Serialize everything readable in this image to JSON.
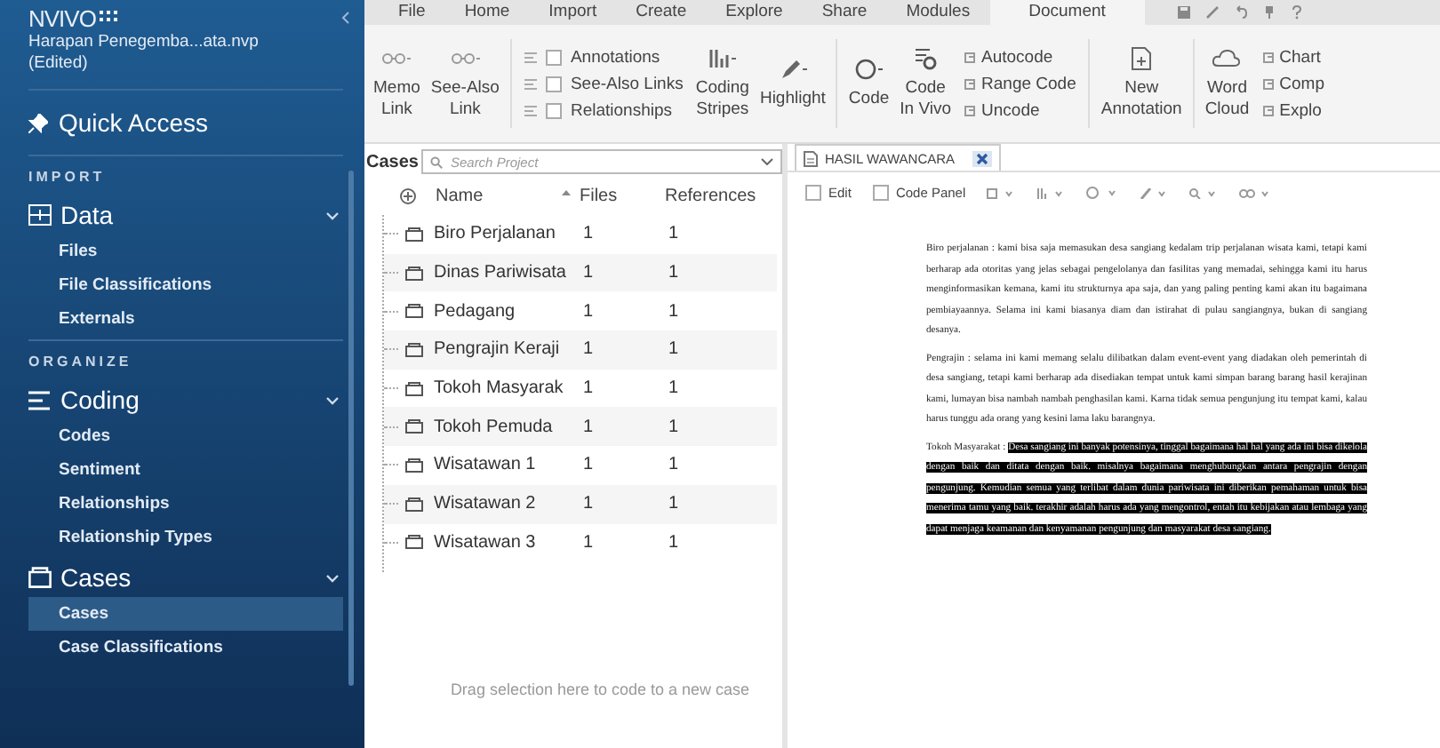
{
  "sidebar": {
    "app_name": "NVIVO",
    "project_name": "Harapan Penegemba...ata.nvp",
    "project_status": "(Edited)",
    "quick_access": "Quick Access",
    "sections": [
      {
        "heading": "IMPORT",
        "groups": [
          {
            "kind": "data",
            "label": "Data",
            "expanded": true,
            "items": [
              {
                "label": "Files",
                "selected": false
              },
              {
                "label": "File Classifications",
                "selected": false
              },
              {
                "label": "Externals",
                "selected": false
              }
            ]
          }
        ]
      },
      {
        "heading": "ORGANIZE",
        "groups": [
          {
            "kind": "coding",
            "label": "Coding",
            "expanded": true,
            "items": [
              {
                "label": "Codes",
                "selected": false
              },
              {
                "label": "Sentiment",
                "selected": false
              },
              {
                "label": "Relationships",
                "selected": false
              },
              {
                "label": "Relationship Types",
                "selected": false
              }
            ]
          },
          {
            "kind": "cases",
            "label": "Cases",
            "expanded": true,
            "items": [
              {
                "label": "Cases",
                "selected": true
              },
              {
                "label": "Case Classifications",
                "selected": false
              }
            ]
          }
        ]
      }
    ]
  },
  "ribbon": {
    "tabs": [
      {
        "label": "File",
        "selected": false
      },
      {
        "label": "Home",
        "selected": false
      },
      {
        "label": "Import",
        "selected": false
      },
      {
        "label": "Create",
        "selected": false
      },
      {
        "label": "Explore",
        "selected": false
      },
      {
        "label": "Share",
        "selected": false
      },
      {
        "label": "Modules",
        "selected": false
      },
      {
        "label": "Document",
        "selected": true
      }
    ],
    "items": [
      {
        "kind": "large",
        "lines": [
          "Memo",
          "Link"
        ]
      },
      {
        "kind": "large",
        "lines": [
          "See-Also",
          "Link"
        ]
      },
      {
        "kind": "stack",
        "rows": [
          {
            "kind": "check",
            "label": "Annotations",
            "checked": false
          },
          {
            "kind": "check",
            "label": "See-Also Links",
            "checked": false
          },
          {
            "kind": "check",
            "label": "Relationships",
            "checked": false
          }
        ]
      },
      {
        "kind": "large",
        "lines": [
          "Coding",
          "Stripes"
        ]
      },
      {
        "kind": "large",
        "lines": [
          "Highlight"
        ]
      },
      {
        "kind": "large",
        "lines": [
          "Code"
        ]
      },
      {
        "kind": "large",
        "lines": [
          "Code",
          "In Vivo"
        ]
      },
      {
        "kind": "stack",
        "rows": [
          {
            "kind": "command",
            "label": "Autocode"
          },
          {
            "kind": "command",
            "label": "Range Code"
          },
          {
            "kind": "command",
            "label": "Uncode"
          }
        ]
      },
      {
        "kind": "large",
        "lines": [
          "New",
          "Annotation"
        ]
      },
      {
        "kind": "large",
        "lines": [
          "Word",
          "Cloud"
        ]
      },
      {
        "kind": "stack",
        "rows": [
          {
            "kind": "command",
            "label": "Chart"
          },
          {
            "kind": "command",
            "label": "Comp"
          },
          {
            "kind": "command",
            "label": "Explo"
          }
        ]
      }
    ]
  },
  "cases": {
    "title": "Cases",
    "search": {
      "placeholder": "Search Project"
    },
    "columns": [
      "Name",
      "Files",
      "References"
    ],
    "rows": [
      {
        "name": "Biro Perjalanan",
        "files": "1",
        "references": "1"
      },
      {
        "name": "Dinas Pariwisata",
        "files": "1",
        "references": "1"
      },
      {
        "name": "Pedagang",
        "files": "1",
        "references": "1"
      },
      {
        "name": "Pengrajin Keraji",
        "files": "1",
        "references": "1"
      },
      {
        "name": "Tokoh Masyarak",
        "files": "1",
        "references": "1"
      },
      {
        "name": "Tokoh Pemuda",
        "files": "1",
        "references": "1"
      },
      {
        "name": "Wisatawan 1",
        "files": "1",
        "references": "1"
      },
      {
        "name": "Wisatawan 2",
        "files": "1",
        "references": "1"
      },
      {
        "name": "Wisatawan 3",
        "files": "1",
        "references": "1"
      }
    ],
    "empty_hint": "Drag selection here to code to a new case"
  },
  "document": {
    "tab_title": "HASIL WAWANCARA",
    "checks": [
      {
        "label": "Edit",
        "checked": false
      },
      {
        "label": "Code Panel",
        "checked": false
      }
    ],
    "paragraphs": [
      {
        "segments": [
          {
            "text": "Biro perjalanan : kami bisa saja memasukan desa sangiang kedalam trip perjalanan wisata kami, tetapi kami berharap ada otoritas yang jelas sebagai pengelolanya dan fasilitas yang memadai, sehingga kami itu harus menginformasikan kemana, kami itu strukturnya apa saja, dan yang paling penting kami akan itu bagaimana pembiayaannya. Selama ini kami biasanya diam dan istirahat di pulau sangiangnya, bukan di sangiang desanya.",
            "highlighted": false
          }
        ]
      },
      {
        "segments": [
          {
            "text": "Pengrajin : selama ini kami memang selalu dilibatkan dalam event-event yang diadakan oleh pemerintah di desa sangiang, tetapi kami berharap ada disediakan tempat untuk kami simpan barang barang hasil kerajinan kami, lumayan bisa nambah nambah penghasilan kami. Karna tidak semua pengunjung itu tempat kami, kalau harus tunggu ada orang yang kesini lama laku barangnya.",
            "highlighted": false
          }
        ]
      },
      {
        "segments": [
          {
            "text": "Tokoh Masyarakat : ",
            "highlighted": false
          },
          {
            "text": "Desa sangiang ini banyak potensinya, tinggal bagaimana hal hal yang ada ini bisa dikelola dengan baik dan ditata dengan baik. misalnya bagaimana menghubungkan antara pengrajin dengan pengunjung. Kemudian semua yang terlibat dalam dunia pariwisata ini diberikan pemahaman untuk bisa menerima tamu yang baik. terakhir adalah harus ada yang mengontrol, entah itu kebijakan atau lembaga yang dapat menjaga keamanan dan kenyamanan pengunjung dan masyarakat desa sangiang.",
            "highlighted": true
          }
        ]
      }
    ]
  }
}
